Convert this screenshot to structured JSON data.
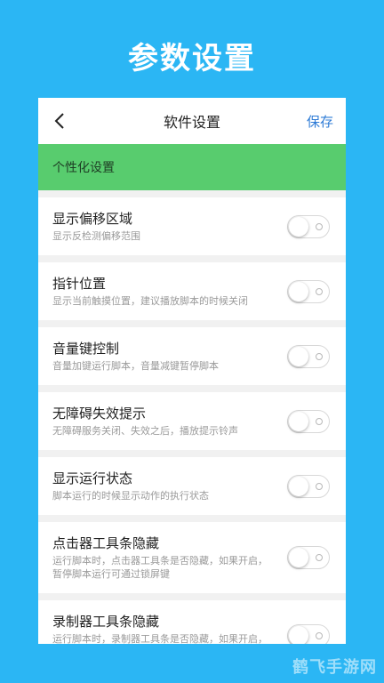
{
  "banner_title": "参数设置",
  "nav": {
    "title": "软件设置",
    "save_label": "保存",
    "back_icon": "chevron-left-icon"
  },
  "group_header": "个性化设置",
  "settings": [
    {
      "title": "显示偏移区域",
      "desc": "显示反检测偏移范围",
      "enabled": false
    },
    {
      "title": "指针位置",
      "desc": "显示当前触摸位置，建议播放脚本的时候关闭",
      "enabled": false
    },
    {
      "title": "音量键控制",
      "desc": "音量加键运行脚本，音量减键暂停脚本",
      "enabled": false
    },
    {
      "title": "无障碍失效提示",
      "desc": "无障碍服务关闭、失效之后，播放提示铃声",
      "enabled": false
    },
    {
      "title": "显示运行状态",
      "desc": "脚本运行的时候显示动作的执行状态",
      "enabled": false
    },
    {
      "title": "点击器工具条隐藏",
      "desc": "运行脚本时，点击器工具条是否隐藏，如果开启，暂停脚本运行可通过锁屏键",
      "enabled": false
    },
    {
      "title": "录制器工具条隐藏",
      "desc": "运行脚本时，录制器工具条是否隐藏，如果开启，暂停脚本运行可通过锁屏键",
      "enabled": false
    }
  ],
  "watermark": "鹤飞手游网",
  "colors": {
    "background": "#2BB6F4",
    "group_header": "#58CC6E",
    "save_text": "#2E7BD6"
  }
}
